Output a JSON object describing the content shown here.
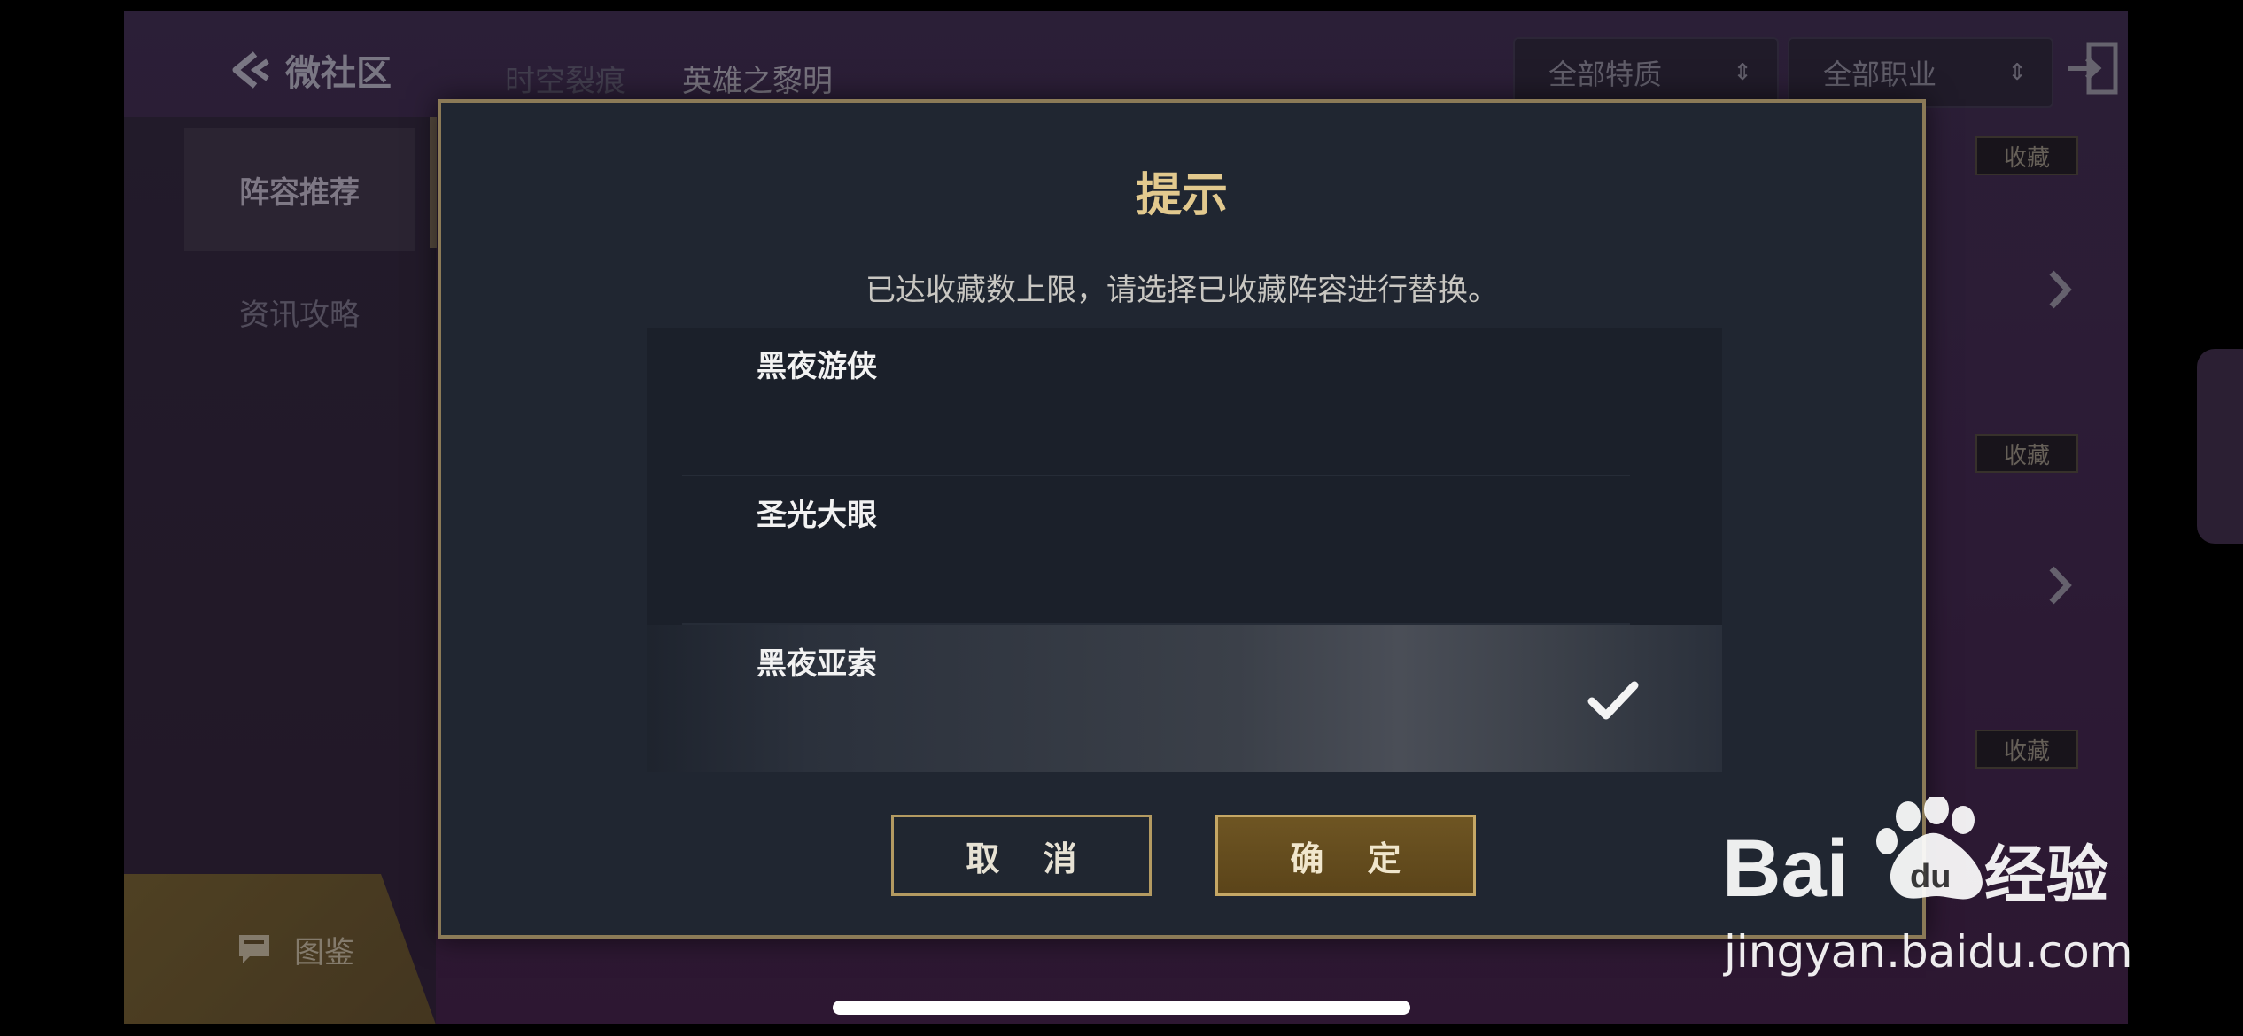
{
  "topbar": {
    "back_label": "微社区",
    "tabs": [
      {
        "label": "时空裂痕",
        "active": false
      },
      {
        "label": "英雄之黎明",
        "active": true
      }
    ],
    "filters": [
      {
        "label": "全部特质"
      },
      {
        "label": "全部职业"
      }
    ]
  },
  "sidebar": {
    "items": [
      {
        "label": "阵容推荐",
        "active": true
      },
      {
        "label": "资讯攻略",
        "active": false
      }
    ],
    "tujian_label": "图鉴"
  },
  "content": {
    "fav_label": "收藏"
  },
  "dialog": {
    "title": "提示",
    "message": "已达收藏数上限，请选择已收藏阵容进行替换。",
    "options": [
      {
        "name": "黑夜游侠",
        "selected": false
      },
      {
        "name": "圣光大眼",
        "selected": false
      },
      {
        "name": "黑夜亚索",
        "selected": true
      }
    ],
    "cancel_label": "取 消",
    "confirm_label": "确 定"
  },
  "watermark": {
    "brand": "Baidu经验",
    "url": "jingyan.baidu.com"
  },
  "colors": {
    "gold": "#8b7a57",
    "title_gold": "#e2c98e",
    "dialog_bg": "#202631"
  }
}
